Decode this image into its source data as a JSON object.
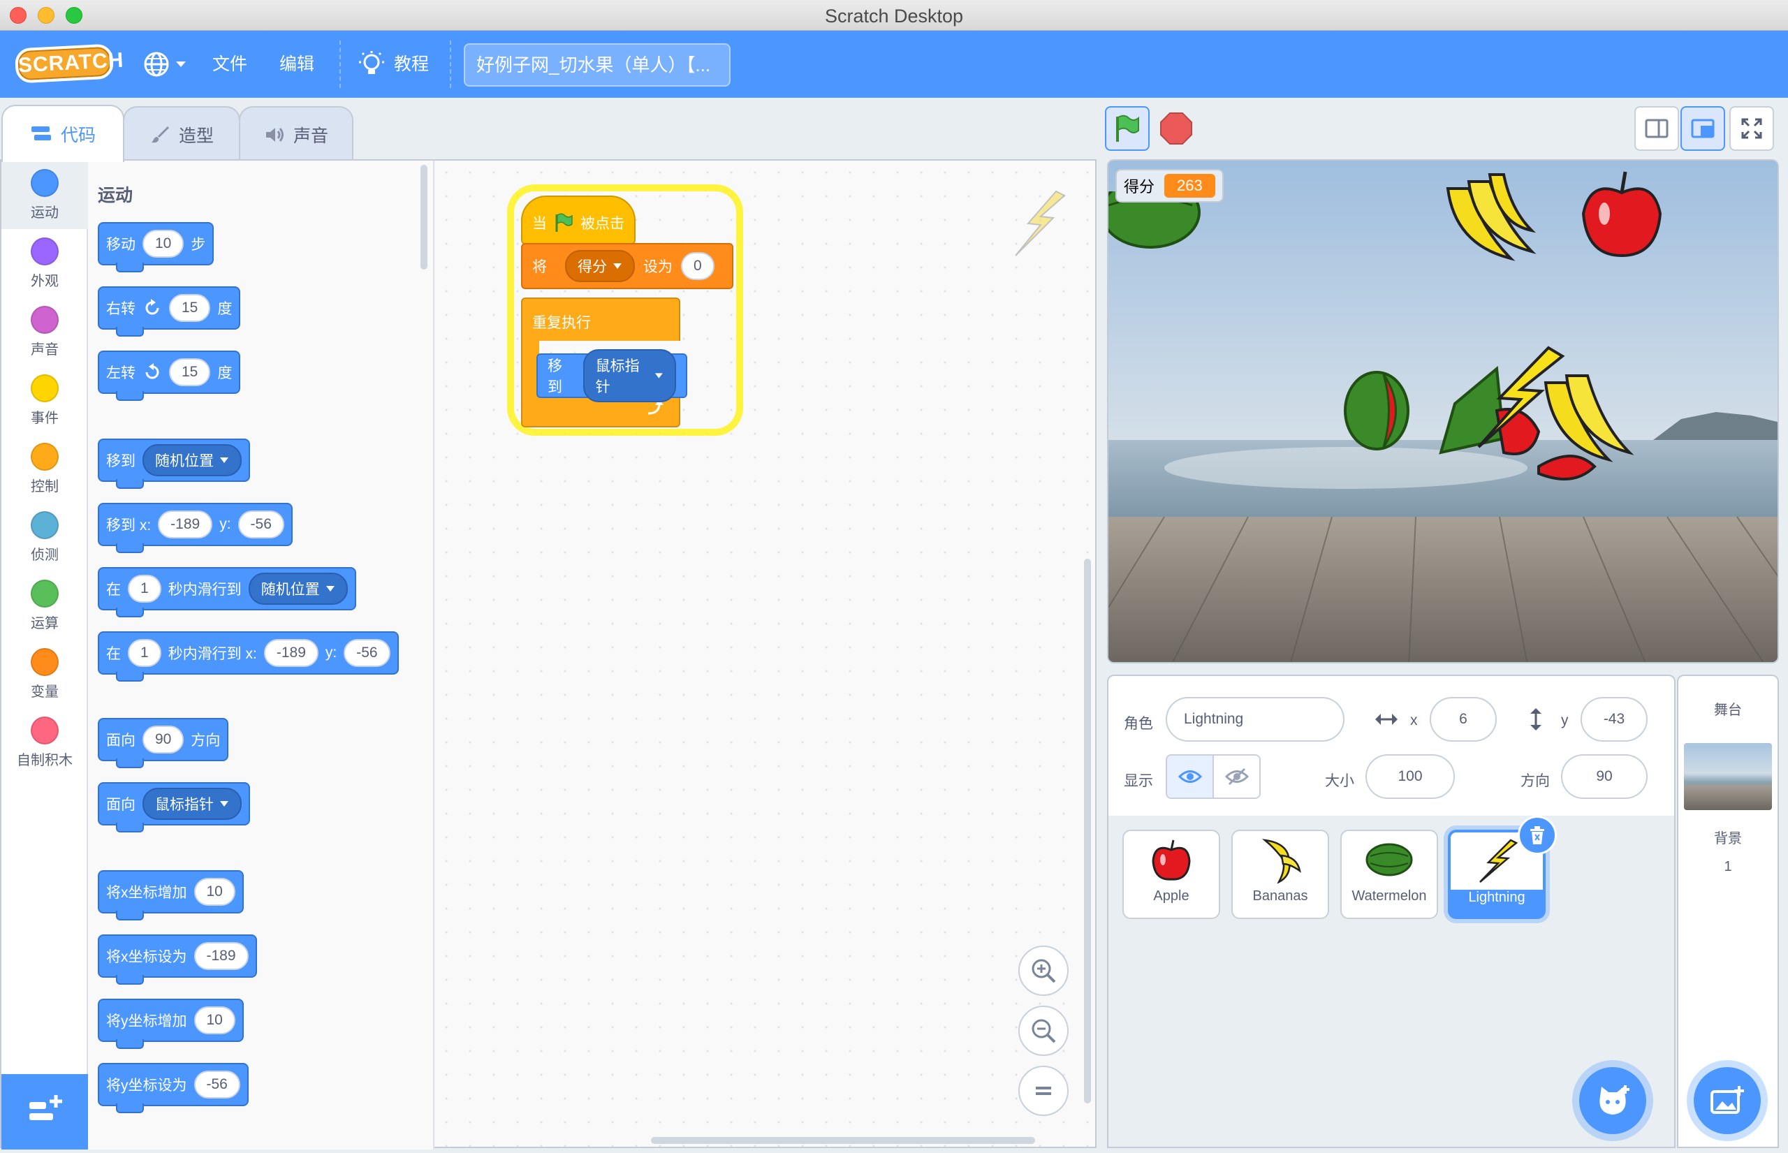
{
  "window": {
    "title": "Scratch Desktop"
  },
  "menubar": {
    "logo": "SCRATCH",
    "file": "文件",
    "edit": "编辑",
    "tutorials": "教程",
    "project_title": "好例子网_切水果（单人）【..."
  },
  "tabs": {
    "code": "代码",
    "costumes": "造型",
    "sounds": "声音"
  },
  "categories": [
    {
      "label": "运动",
      "color": "#4c97ff"
    },
    {
      "label": "外观",
      "color": "#9966ff"
    },
    {
      "label": "声音",
      "color": "#cf63cf"
    },
    {
      "label": "事件",
      "color": "#ffd500"
    },
    {
      "label": "控制",
      "color": "#ffab19"
    },
    {
      "label": "侦测",
      "color": "#5cb1d6"
    },
    {
      "label": "运算",
      "color": "#59c059"
    },
    {
      "label": "变量",
      "color": "#ff8c1a"
    },
    {
      "label": "自制积木",
      "color": "#ff6680"
    }
  ],
  "palette": {
    "title": "运动",
    "blocks": {
      "move": {
        "a": "移动",
        "v": "10",
        "b": "步"
      },
      "turn_right": {
        "a": "右转",
        "v": "15",
        "b": "度"
      },
      "turn_left": {
        "a": "左转",
        "v": "15",
        "b": "度"
      },
      "goto": {
        "a": "移到",
        "dd": "随机位置"
      },
      "goto_xy": {
        "a": "移到 x:",
        "x": "-189",
        "yl": "y:",
        "y": "-56"
      },
      "glide": {
        "a": "在",
        "v": "1",
        "b": "秒内滑行到",
        "dd": "随机位置"
      },
      "glide_xy": {
        "a": "在",
        "v": "1",
        "b": "秒内滑行到 x:",
        "x": "-189",
        "yl": "y:",
        "y": "-56"
      },
      "point_dir": {
        "a": "面向",
        "v": "90",
        "b": "方向"
      },
      "point_towards": {
        "a": "面向",
        "dd": "鼠标指针"
      },
      "change_x": {
        "a": "将x坐标增加",
        "v": "10"
      },
      "set_x": {
        "a": "将x坐标设为",
        "v": "-189"
      },
      "change_y": {
        "a": "将y坐标增加",
        "v": "10"
      },
      "set_y": {
        "a": "将y坐标设为",
        "v": "-56"
      }
    }
  },
  "script": {
    "hat_a": "当",
    "hat_b": "被点击",
    "set_a": "将",
    "set_var": "得分",
    "set_b": "设为",
    "set_v": "0",
    "forever": "重复执行",
    "goto_a": "移到",
    "goto_dd": "鼠标指针"
  },
  "stage": {
    "monitor_label": "得分",
    "monitor_value": "263"
  },
  "sprite_info": {
    "sprite_label": "角色",
    "sprite_name": "Lightning",
    "x_label": "x",
    "x_value": "6",
    "y_label": "y",
    "y_value": "-43",
    "show_label": "显示",
    "size_label": "大小",
    "size_value": "100",
    "direction_label": "方向",
    "direction_value": "90"
  },
  "sprites": [
    {
      "name": "Apple",
      "icon": "apple-icon"
    },
    {
      "name": "Bananas",
      "icon": "banana-icon"
    },
    {
      "name": "Watermelon",
      "icon": "watermelon-icon"
    },
    {
      "name": "Lightning",
      "icon": "lightning-icon",
      "selected": true
    }
  ],
  "stage_panel": {
    "title": "舞台",
    "backdrops_label": "背景",
    "backdrops_count": "1"
  },
  "colors": {
    "menubar": "#4c97ff",
    "motion": "#4c97ff",
    "control": "#ffab19",
    "events": "#ffbf00",
    "variables": "#ff8c1a"
  }
}
